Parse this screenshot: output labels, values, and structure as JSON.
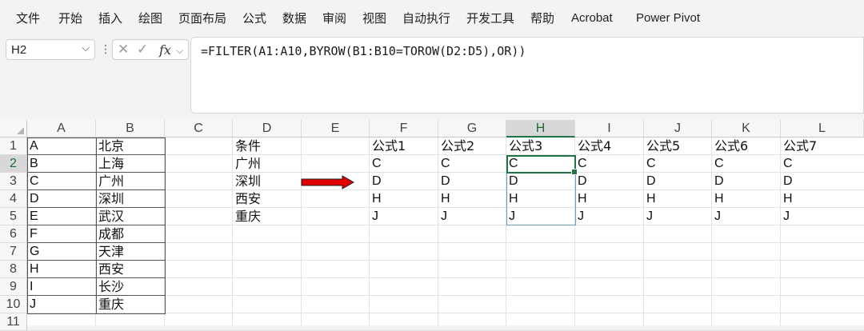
{
  "ribbon": {
    "tabs": [
      "文件",
      "开始",
      "插入",
      "绘图",
      "页面布局",
      "公式",
      "数据",
      "审阅",
      "视图",
      "自动执行",
      "开发工具",
      "帮助",
      "Acrobat",
      "Power Pivot"
    ]
  },
  "formula_bar": {
    "name_box": "H2",
    "formula": "=FILTER(A1:A10,BYROW(B1:B10=TOROW(D2:D5),OR))"
  },
  "columns": [
    "A",
    "B",
    "C",
    "D",
    "E",
    "F",
    "G",
    "H",
    "I",
    "J",
    "K",
    "L"
  ],
  "rows": [
    "1",
    "2",
    "3",
    "4",
    "5",
    "6",
    "7",
    "8",
    "9",
    "10",
    "11"
  ],
  "selected_cell": "H2",
  "cells": {
    "A": [
      "A",
      "B",
      "C",
      "D",
      "E",
      "F",
      "G",
      "H",
      "I",
      "J"
    ],
    "B": [
      "北京",
      "上海",
      "广州",
      "深圳",
      "武汉",
      "成都",
      "天津",
      "西安",
      "长沙",
      "重庆"
    ],
    "D": [
      "条件",
      "广州",
      "深圳",
      "西安",
      "重庆"
    ],
    "headers": [
      "公式1",
      "公式2",
      "公式3",
      "公式4",
      "公式5",
      "公式6",
      "公式7"
    ],
    "results": [
      "C",
      "D",
      "H",
      "J"
    ]
  },
  "colors": {
    "accent": "#217346",
    "arrow": "#e00000"
  }
}
